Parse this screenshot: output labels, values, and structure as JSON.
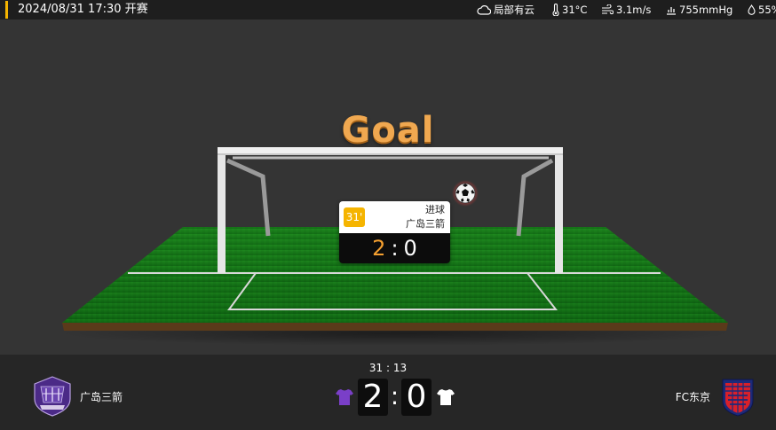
{
  "header": {
    "match_time": "2024/08/31 17:30 开赛",
    "weather": {
      "condition": "局部有云",
      "temperature": "31°C",
      "wind": "3.1m/s",
      "pressure": "755mmHg",
      "humidity": "55%"
    },
    "accent_color": "#f5b400"
  },
  "stage": {
    "title": "Goal",
    "event": {
      "minute": "31'",
      "type": "进球",
      "team": "广岛三箭",
      "score_home": "2",
      "score_separator": ":",
      "score_away": "0"
    }
  },
  "scoreboard": {
    "half_time_score": "31 : 13",
    "home_team": "广岛三箭",
    "away_team": "FC东京",
    "home_score": "2",
    "away_score": "0",
    "separator": ":",
    "home_jersey_color": "#7a3fc8",
    "away_jersey_color": "#ffffff",
    "home_logo_icon": "sanfrecce-hiroshima-crest-icon",
    "away_logo_icon": "fc-tokyo-crest-icon"
  }
}
